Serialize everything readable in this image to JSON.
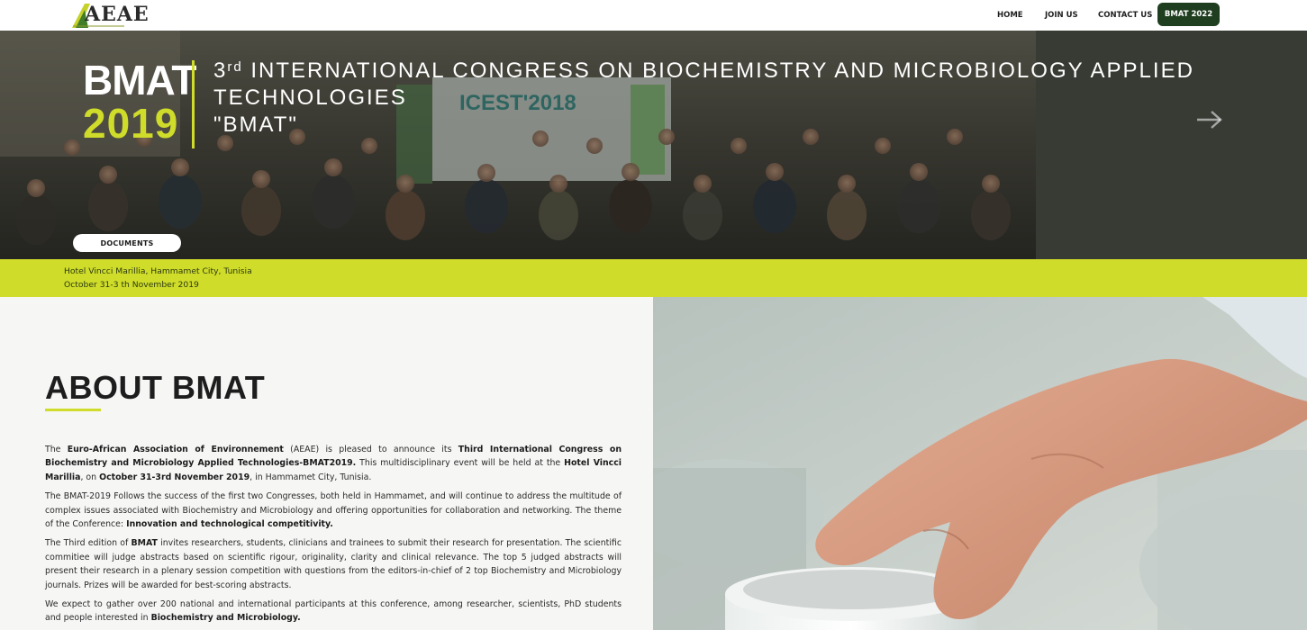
{
  "header": {
    "logo_text": "AEAE",
    "nav": [
      {
        "label": "HOME"
      },
      {
        "label": "JOIN US"
      },
      {
        "label": "CONTACT US"
      }
    ],
    "cta_label": "BMAT 2022"
  },
  "hero": {
    "event_name": "BMAT",
    "event_year": "2019",
    "title_ordinal": "3",
    "title_ordinal_suffix": "rd",
    "title_line1": "INTERNATIONAL CONGRESS ON BIOCHEMISTRY AND MICROBIOLOGY APPLIED TECHNOLOGIES",
    "title_line2": "\"BMAT\"",
    "documents_label": "DOCUMENTS",
    "banner_text": "ICEST'2018",
    "next_arrow_icon": "arrow-right-icon"
  },
  "venue": {
    "location": "Hotel Vincci Marillia, Hammamet City, Tunisia",
    "dates": "October 31-3 th November 2019"
  },
  "about": {
    "title": "ABOUT BMAT",
    "p1": {
      "t1": "The ",
      "b1": "Euro-African Association of Environnement",
      "t2": " (AEAE) is pleased to announce its ",
      "b2": "Third International Congress on Biochemistry and Microbiology Applied Technologies-BMAT2019.",
      "t3": " This multidisciplinary event will be held at the ",
      "b3": "Hotel Vincci Marillia",
      "t4": ", on ",
      "b4": "October 31-3rd November 2019",
      "t5": ", in Hammamet City, Tunisia."
    },
    "p2": {
      "t1": "The BMAT-2019 Follows the success of the first two Congresses, both held in Hammamet, and will continue to address the multitude of complex issues associated with Biochemistry and Microbiology and offering opportunities for collaboration and networking. The theme of the Conference: ",
      "b1": "Innovation and technological competitivity."
    },
    "p3": {
      "t1": "The Third edition of ",
      "b1": "BMAT",
      "t2": " invites researchers, students, clinicians and trainees to submit their research for presentation. The scientific commitiee will judge abstracts based on scientific rigour, originality, clarity and clinical relevance. The top 5 judged abstracts will present their research in a plenary session competition with questions from the editors-in-chief of 2 top Biochemistry and Microbiology journals. Prizes will be awarded for best-scoring abstracts."
    },
    "p4": {
      "t1": "We expect to gather over 200 national and international participants at this conference, among researcher, scientists, PhD students and people interested in ",
      "b1": "Biochemistry and Microbiology."
    }
  },
  "colors": {
    "accent": "#cfdc2a",
    "cta_bg": "#1f3d1f",
    "about_bg": "#f6f6f5"
  }
}
